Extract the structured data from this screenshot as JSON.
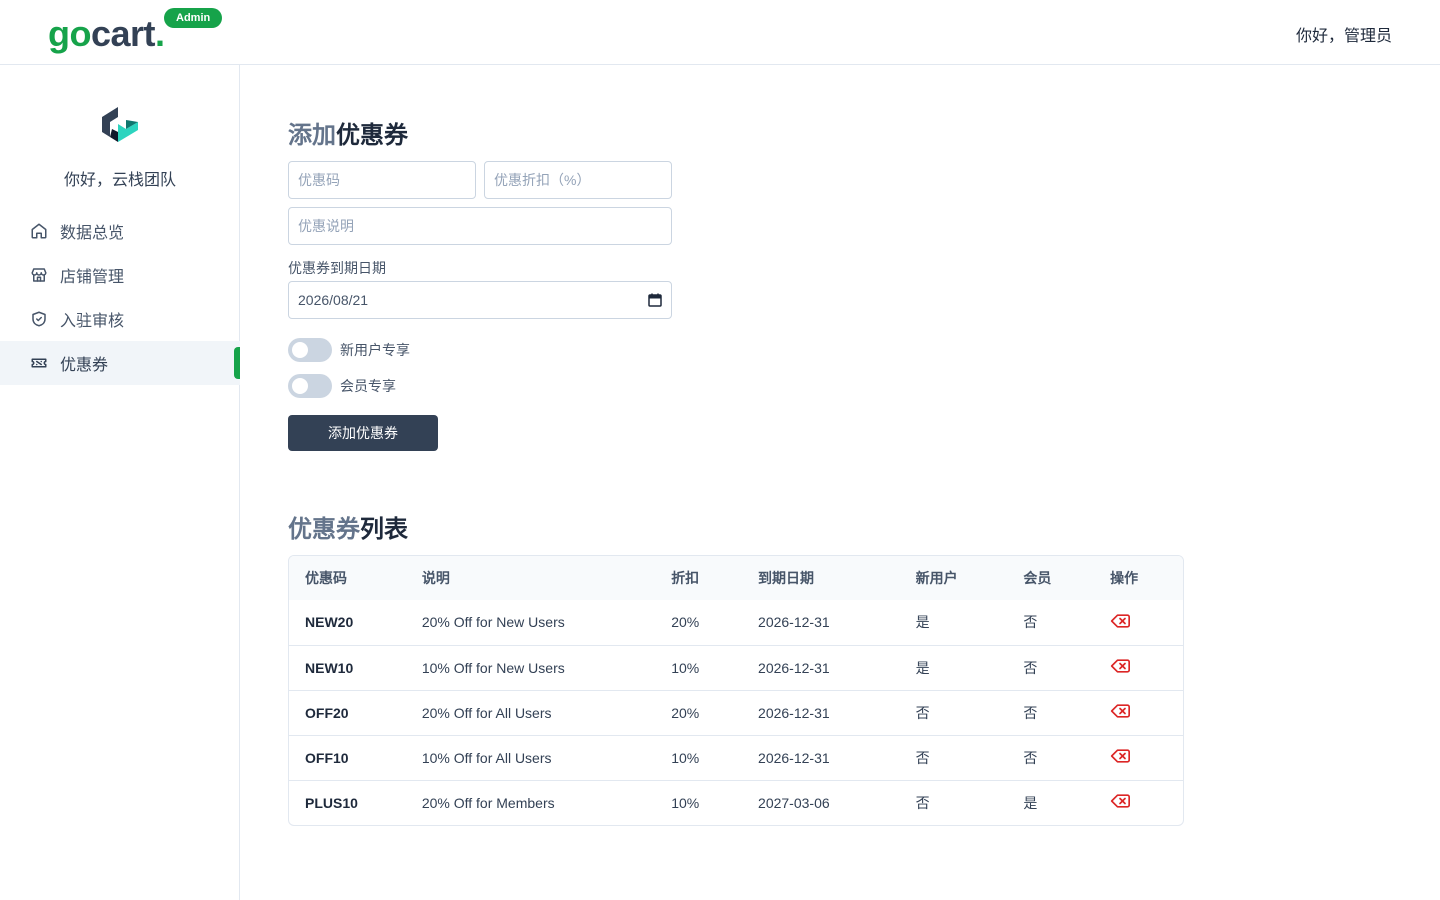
{
  "header": {
    "logo_go": "go",
    "logo_cart": "cart",
    "logo_dot": ".",
    "badge": "Admin",
    "greeting": "你好，管理员"
  },
  "sidebar": {
    "greeting": "你好，云栈团队",
    "items": [
      {
        "label": "数据总览",
        "icon": "home-icon"
      },
      {
        "label": "店铺管理",
        "icon": "store-icon"
      },
      {
        "label": "入驻审核",
        "icon": "shield-check-icon"
      },
      {
        "label": "优惠券",
        "icon": "ticket-icon",
        "active": true
      }
    ]
  },
  "form": {
    "title_light": "添加",
    "title_bold": "优惠券",
    "code_placeholder": "优惠码",
    "discount_placeholder": "优惠折扣（%）",
    "description_placeholder": "优惠说明",
    "date_label": "优惠券到期日期",
    "date_value": "2026/08/21",
    "toggle_new_user": "新用户专享",
    "toggle_member": "会员专享",
    "new_user_on": false,
    "member_on": false,
    "submit_label": "添加优惠券"
  },
  "list": {
    "title_light": "优惠券",
    "title_bold": "列表",
    "columns": [
      "优惠码",
      "说明",
      "折扣",
      "到期日期",
      "新用户",
      "会员",
      "操作"
    ],
    "rows": [
      {
        "code": "NEW20",
        "description": "20% Off for New Users",
        "discount": "20%",
        "expires": "2026-12-31",
        "new_user": "是",
        "member": "否"
      },
      {
        "code": "NEW10",
        "description": "10% Off for New Users",
        "discount": "10%",
        "expires": "2026-12-31",
        "new_user": "是",
        "member": "否"
      },
      {
        "code": "OFF20",
        "description": "20% Off for All Users",
        "discount": "20%",
        "expires": "2026-12-31",
        "new_user": "否",
        "member": "否"
      },
      {
        "code": "OFF10",
        "description": "10% Off for All Users",
        "discount": "10%",
        "expires": "2026-12-31",
        "new_user": "否",
        "member": "否"
      },
      {
        "code": "PLUS10",
        "description": "20% Off for Members",
        "discount": "10%",
        "expires": "2027-03-06",
        "new_user": "否",
        "member": "是"
      }
    ]
  },
  "colors": {
    "brand_green": "#16a34a",
    "dark_button": "#334155",
    "delete_red": "#dc2626"
  }
}
